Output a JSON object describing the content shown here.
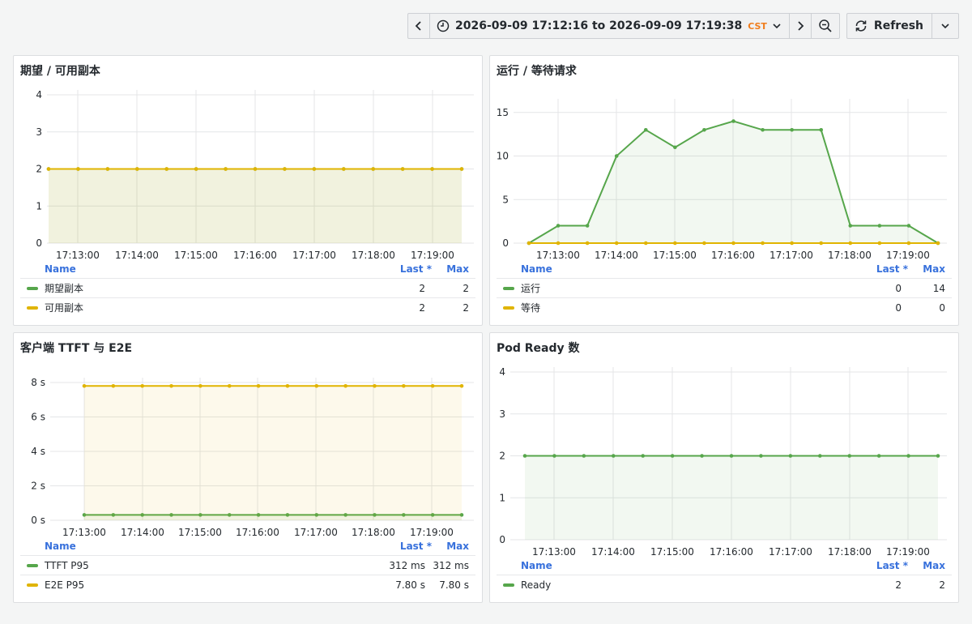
{
  "toolbar": {
    "prev_icon": "chevron-left-icon",
    "clock_icon": "clock-icon",
    "time_range": "2026-09-09 17:12:16 to 2026-09-09 17:19:38",
    "timezone": "CST",
    "next_icon": "chevron-right-icon",
    "zoom_icon": "zoom-out-icon",
    "refresh_label": "Refresh"
  },
  "legend_headers": {
    "name": "Name",
    "last": "Last *",
    "max": "Max"
  },
  "colors": {
    "green": "#56a64b",
    "yellow": "#e0b400"
  },
  "panels": [
    {
      "title": "期望 / 可用副本",
      "chart_data": {
        "type": "line",
        "x": [
          "17:12:30",
          "17:12:45",
          "17:13:00",
          "17:13:15",
          "17:13:30",
          "17:13:45",
          "17:14:00",
          "17:14:15",
          "17:14:30",
          "17:14:45",
          "17:15:00",
          "17:15:15",
          "17:15:30",
          "17:15:45",
          "17:16:00"
        ],
        "xticks": [
          "17:13:00",
          "17:14:00",
          "17:15:00",
          "17:16:00",
          "17:17:00",
          "17:18:00",
          "17:19:00"
        ],
        "yticks": [
          "0",
          "1",
          "2",
          "3",
          "4"
        ],
        "ylim": [
          0,
          4
        ],
        "series": [
          {
            "name": "期望副本",
            "color": "#56a64b",
            "values": [
              2,
              2,
              2,
              2,
              2,
              2,
              2,
              2,
              2,
              2,
              2,
              2,
              2,
              2,
              2
            ],
            "last": "2",
            "max": "2"
          },
          {
            "name": "可用副本",
            "color": "#e0b400",
            "values": [
              2,
              2,
              2,
              2,
              2,
              2,
              2,
              2,
              2,
              2,
              2,
              2,
              2,
              2,
              2
            ],
            "last": "2",
            "max": "2"
          }
        ]
      }
    },
    {
      "title": "运行 / 等待请求",
      "chart_data": {
        "type": "line",
        "x": [
          1,
          2,
          3,
          4,
          5,
          6,
          7,
          8,
          9,
          10,
          11,
          12,
          13,
          14,
          15
        ],
        "xticks": [
          "17:13:00",
          "17:14:00",
          "17:15:00",
          "17:16:00",
          "17:17:00",
          "17:18:00",
          "17:19:00"
        ],
        "yticks": [
          "0",
          "5",
          "10",
          "15"
        ],
        "ylim": [
          0,
          16
        ],
        "series": [
          {
            "name": "运行",
            "color": "#56a64b",
            "values": [
              0,
              2,
              2,
              10,
              13,
              11,
              13,
              14,
              13,
              13,
              13,
              2,
              2,
              2,
              0
            ],
            "last": "0",
            "max": "14"
          },
          {
            "name": "等待",
            "color": "#e0b400",
            "values": [
              0,
              0,
              0,
              0,
              0,
              0,
              0,
              0,
              0,
              0,
              0,
              0,
              0,
              0,
              0
            ],
            "last": "0",
            "max": "0"
          }
        ]
      }
    },
    {
      "title": "客户端 TTFT 与 E2E",
      "chart_data": {
        "type": "line",
        "x": [
          1,
          2,
          3,
          4,
          5,
          6,
          7,
          8,
          9,
          10,
          11,
          12,
          13,
          14
        ],
        "xticks": [
          "17:13:00",
          "17:14:00",
          "17:15:00",
          "17:16:00",
          "17:17:00",
          "17:18:00",
          "17:19:00"
        ],
        "yticks": [
          "0 s",
          "2 s",
          "4 s",
          "6 s",
          "8 s"
        ],
        "ylim": [
          0,
          8
        ],
        "series": [
          {
            "name": "TTFT P95",
            "color": "#56a64b",
            "values": [
              0.312,
              0.312,
              0.312,
              0.312,
              0.312,
              0.312,
              0.312,
              0.312,
              0.312,
              0.312,
              0.312,
              0.312,
              0.312,
              0.312
            ],
            "last": "312 ms",
            "max": "312 ms"
          },
          {
            "name": "E2E P95",
            "color": "#e0b400",
            "values": [
              7.8,
              7.8,
              7.8,
              7.8,
              7.8,
              7.8,
              7.8,
              7.8,
              7.8,
              7.8,
              7.8,
              7.8,
              7.8,
              7.8
            ],
            "last": "7.80 s",
            "max": "7.80 s"
          }
        ]
      }
    },
    {
      "title": "Pod Ready 数",
      "chart_data": {
        "type": "line",
        "x": [
          1,
          2,
          3,
          4,
          5,
          6,
          7,
          8,
          9,
          10,
          11,
          12,
          13,
          14,
          15
        ],
        "xticks": [
          "17:13:00",
          "17:14:00",
          "17:15:00",
          "17:16:00",
          "17:17:00",
          "17:18:00",
          "17:19:00"
        ],
        "yticks": [
          "0",
          "1",
          "2",
          "3",
          "4"
        ],
        "ylim": [
          0,
          4
        ],
        "series": [
          {
            "name": "Ready",
            "color": "#56a64b",
            "values": [
              2,
              2,
              2,
              2,
              2,
              2,
              2,
              2,
              2,
              2,
              2,
              2,
              2,
              2,
              2
            ],
            "last": "2",
            "max": "2"
          }
        ]
      }
    }
  ]
}
